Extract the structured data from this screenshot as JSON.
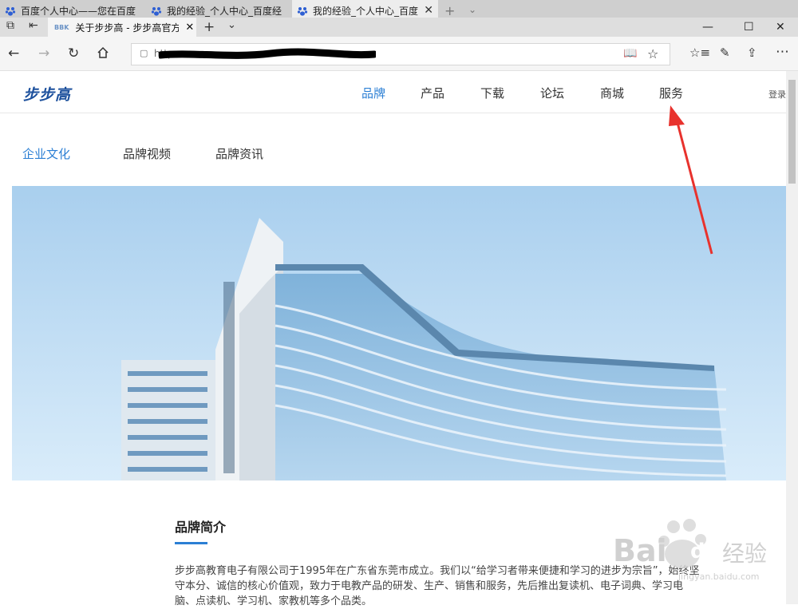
{
  "outer_tabs": [
    {
      "title": "百度个人中心——您在百度"
    },
    {
      "title": "我的经验_个人中心_百度经"
    },
    {
      "title": "我的经验_个人中心_百度"
    }
  ],
  "browser": {
    "tab_title": "关于步步高 - 步步高官方",
    "tab_favicon": "BBK",
    "new_tab_symbol": "+",
    "address_text": "https",
    "window_controls": {
      "minimize": "—",
      "maximize": "☐",
      "close": "✕"
    }
  },
  "site": {
    "logo": "步步高",
    "nav": [
      "品牌",
      "产品",
      "下载",
      "论坛",
      "商城",
      "服务"
    ],
    "nav_active_index": 0,
    "login": "登录",
    "subnav": [
      "企业文化",
      "品牌视频",
      "品牌资讯"
    ],
    "subnav_active_index": 0,
    "intro_title": "品牌简介",
    "intro_body": "步步高教育电子有限公司于1995年在广东省东莞市成立。我们以“给学习者带来便捷和学习的进步为宗旨”，始终坚守本分、诚信的核心价值观，致力于电教产品的研发、生产、销售和服务，先后推出复读机、电子词典、学习电脑、点读机、学习机、家教机等多个品类。"
  },
  "watermark": {
    "brand": "Bai",
    "brand2": "du",
    "suffix": "经验",
    "url": "jingyan.baidu.com"
  },
  "colors": {
    "accent": "#2b7fd4",
    "annotation_arrow": "#e8322d",
    "logo": "#1b4f9c"
  }
}
